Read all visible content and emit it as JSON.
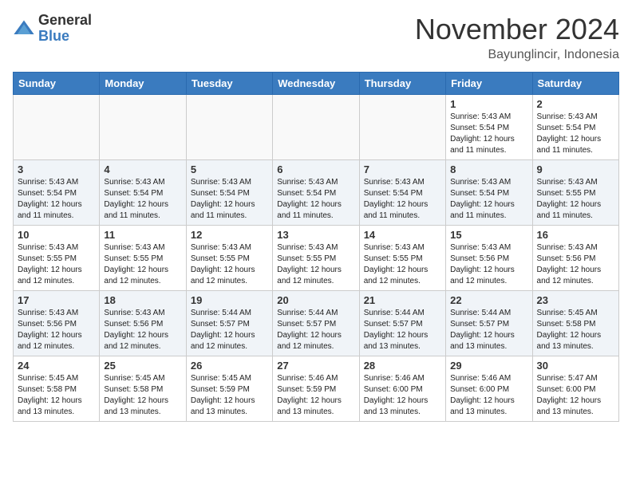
{
  "header": {
    "logo_general": "General",
    "logo_blue": "Blue",
    "month_title": "November 2024",
    "location": "Bayunglincir, Indonesia"
  },
  "days_of_week": [
    "Sunday",
    "Monday",
    "Tuesday",
    "Wednesday",
    "Thursday",
    "Friday",
    "Saturday"
  ],
  "weeks": [
    [
      {
        "day": "",
        "sunrise": "",
        "sunset": "",
        "daylight": "",
        "empty": true
      },
      {
        "day": "",
        "sunrise": "",
        "sunset": "",
        "daylight": "",
        "empty": true
      },
      {
        "day": "",
        "sunrise": "",
        "sunset": "",
        "daylight": "",
        "empty": true
      },
      {
        "day": "",
        "sunrise": "",
        "sunset": "",
        "daylight": "",
        "empty": true
      },
      {
        "day": "",
        "sunrise": "",
        "sunset": "",
        "daylight": "",
        "empty": true
      },
      {
        "day": "1",
        "sunrise": "Sunrise: 5:43 AM",
        "sunset": "Sunset: 5:54 PM",
        "daylight": "Daylight: 12 hours and 11 minutes."
      },
      {
        "day": "2",
        "sunrise": "Sunrise: 5:43 AM",
        "sunset": "Sunset: 5:54 PM",
        "daylight": "Daylight: 12 hours and 11 minutes."
      }
    ],
    [
      {
        "day": "3",
        "sunrise": "Sunrise: 5:43 AM",
        "sunset": "Sunset: 5:54 PM",
        "daylight": "Daylight: 12 hours and 11 minutes."
      },
      {
        "day": "4",
        "sunrise": "Sunrise: 5:43 AM",
        "sunset": "Sunset: 5:54 PM",
        "daylight": "Daylight: 12 hours and 11 minutes."
      },
      {
        "day": "5",
        "sunrise": "Sunrise: 5:43 AM",
        "sunset": "Sunset: 5:54 PM",
        "daylight": "Daylight: 12 hours and 11 minutes."
      },
      {
        "day": "6",
        "sunrise": "Sunrise: 5:43 AM",
        "sunset": "Sunset: 5:54 PM",
        "daylight": "Daylight: 12 hours and 11 minutes."
      },
      {
        "day": "7",
        "sunrise": "Sunrise: 5:43 AM",
        "sunset": "Sunset: 5:54 PM",
        "daylight": "Daylight: 12 hours and 11 minutes."
      },
      {
        "day": "8",
        "sunrise": "Sunrise: 5:43 AM",
        "sunset": "Sunset: 5:54 PM",
        "daylight": "Daylight: 12 hours and 11 minutes."
      },
      {
        "day": "9",
        "sunrise": "Sunrise: 5:43 AM",
        "sunset": "Sunset: 5:55 PM",
        "daylight": "Daylight: 12 hours and 11 minutes."
      }
    ],
    [
      {
        "day": "10",
        "sunrise": "Sunrise: 5:43 AM",
        "sunset": "Sunset: 5:55 PM",
        "daylight": "Daylight: 12 hours and 12 minutes."
      },
      {
        "day": "11",
        "sunrise": "Sunrise: 5:43 AM",
        "sunset": "Sunset: 5:55 PM",
        "daylight": "Daylight: 12 hours and 12 minutes."
      },
      {
        "day": "12",
        "sunrise": "Sunrise: 5:43 AM",
        "sunset": "Sunset: 5:55 PM",
        "daylight": "Daylight: 12 hours and 12 minutes."
      },
      {
        "day": "13",
        "sunrise": "Sunrise: 5:43 AM",
        "sunset": "Sunset: 5:55 PM",
        "daylight": "Daylight: 12 hours and 12 minutes."
      },
      {
        "day": "14",
        "sunrise": "Sunrise: 5:43 AM",
        "sunset": "Sunset: 5:55 PM",
        "daylight": "Daylight: 12 hours and 12 minutes."
      },
      {
        "day": "15",
        "sunrise": "Sunrise: 5:43 AM",
        "sunset": "Sunset: 5:56 PM",
        "daylight": "Daylight: 12 hours and 12 minutes."
      },
      {
        "day": "16",
        "sunrise": "Sunrise: 5:43 AM",
        "sunset": "Sunset: 5:56 PM",
        "daylight": "Daylight: 12 hours and 12 minutes."
      }
    ],
    [
      {
        "day": "17",
        "sunrise": "Sunrise: 5:43 AM",
        "sunset": "Sunset: 5:56 PM",
        "daylight": "Daylight: 12 hours and 12 minutes."
      },
      {
        "day": "18",
        "sunrise": "Sunrise: 5:43 AM",
        "sunset": "Sunset: 5:56 PM",
        "daylight": "Daylight: 12 hours and 12 minutes."
      },
      {
        "day": "19",
        "sunrise": "Sunrise: 5:44 AM",
        "sunset": "Sunset: 5:57 PM",
        "daylight": "Daylight: 12 hours and 12 minutes."
      },
      {
        "day": "20",
        "sunrise": "Sunrise: 5:44 AM",
        "sunset": "Sunset: 5:57 PM",
        "daylight": "Daylight: 12 hours and 12 minutes."
      },
      {
        "day": "21",
        "sunrise": "Sunrise: 5:44 AM",
        "sunset": "Sunset: 5:57 PM",
        "daylight": "Daylight: 12 hours and 13 minutes."
      },
      {
        "day": "22",
        "sunrise": "Sunrise: 5:44 AM",
        "sunset": "Sunset: 5:57 PM",
        "daylight": "Daylight: 12 hours and 13 minutes."
      },
      {
        "day": "23",
        "sunrise": "Sunrise: 5:45 AM",
        "sunset": "Sunset: 5:58 PM",
        "daylight": "Daylight: 12 hours and 13 minutes."
      }
    ],
    [
      {
        "day": "24",
        "sunrise": "Sunrise: 5:45 AM",
        "sunset": "Sunset: 5:58 PM",
        "daylight": "Daylight: 12 hours and 13 minutes."
      },
      {
        "day": "25",
        "sunrise": "Sunrise: 5:45 AM",
        "sunset": "Sunset: 5:58 PM",
        "daylight": "Daylight: 12 hours and 13 minutes."
      },
      {
        "day": "26",
        "sunrise": "Sunrise: 5:45 AM",
        "sunset": "Sunset: 5:59 PM",
        "daylight": "Daylight: 12 hours and 13 minutes."
      },
      {
        "day": "27",
        "sunrise": "Sunrise: 5:46 AM",
        "sunset": "Sunset: 5:59 PM",
        "daylight": "Daylight: 12 hours and 13 minutes."
      },
      {
        "day": "28",
        "sunrise": "Sunrise: 5:46 AM",
        "sunset": "Sunset: 6:00 PM",
        "daylight": "Daylight: 12 hours and 13 minutes."
      },
      {
        "day": "29",
        "sunrise": "Sunrise: 5:46 AM",
        "sunset": "Sunset: 6:00 PM",
        "daylight": "Daylight: 12 hours and 13 minutes."
      },
      {
        "day": "30",
        "sunrise": "Sunrise: 5:47 AM",
        "sunset": "Sunset: 6:00 PM",
        "daylight": "Daylight: 12 hours and 13 minutes."
      }
    ]
  ]
}
